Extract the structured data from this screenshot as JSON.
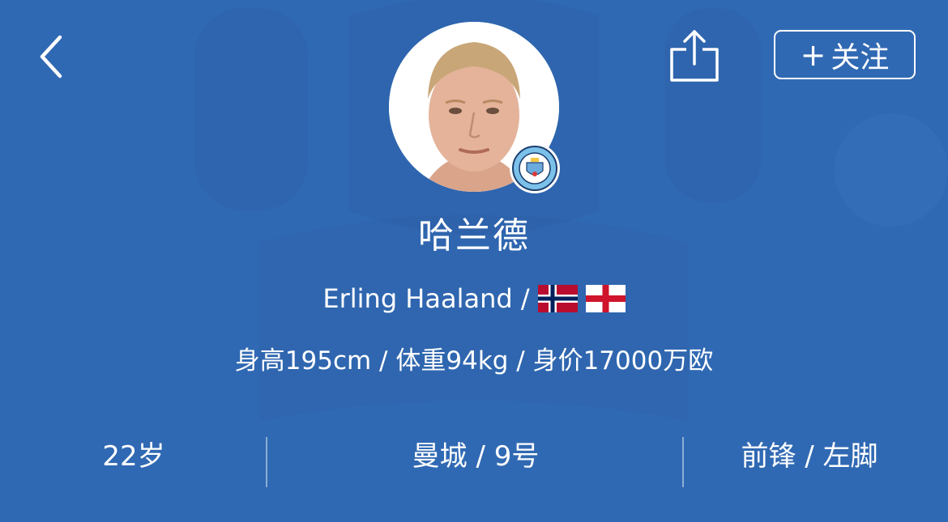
{
  "header": {
    "back_icon": "chevron-left-icon",
    "share_icon": "share-icon",
    "follow_plus": "+",
    "follow_label": "关注"
  },
  "player": {
    "name_cn": "哈兰德",
    "name_en": "Erling Haaland /",
    "nationality_flags": [
      "norway-flag-icon",
      "england-flag-icon"
    ],
    "stats": "身高195cm / 体重94kg / 身价17000万欧",
    "club_badge_icon": "manchester-city-badge-icon"
  },
  "info": {
    "age": "22岁",
    "club_number": "曼城 / 9号",
    "position_foot": "前锋 / 左脚"
  },
  "colors": {
    "background": "#3069b3",
    "text": "#ffffff"
  }
}
